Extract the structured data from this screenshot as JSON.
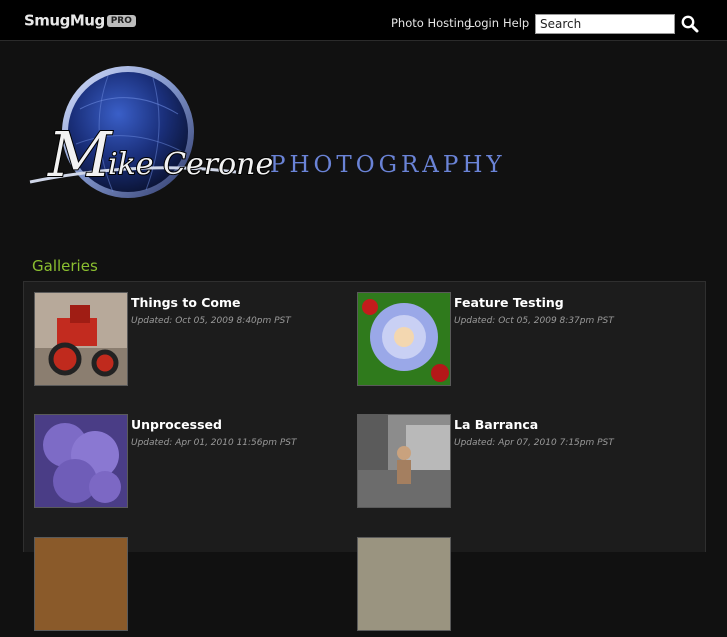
{
  "header": {
    "logo_text": "SmugMug",
    "logo_badge": "PRO",
    "nav": {
      "photo_hosting": "Photo Hosting",
      "login": "Login",
      "help": "Help"
    },
    "search": {
      "value": "",
      "placeholder": "Search",
      "icon": "search-icon"
    }
  },
  "banner": {
    "name_text": "Mike Cerone",
    "subtitle": "PHOTOGRAPHY"
  },
  "galleries": {
    "title": "Galleries",
    "items": [
      {
        "title": "Things to Come",
        "updated": "Updated: Oct 05, 2009 8:40pm PST",
        "thumb": "red-tractor"
      },
      {
        "title": "Feature Testing",
        "updated": "Updated: Oct 05, 2009 8:37pm PST",
        "thumb": "blue-flower"
      },
      {
        "title": "Unprocessed",
        "updated": "Updated: Apr 01, 2010 11:56pm PST",
        "thumb": "purple-hydrangea"
      },
      {
        "title": "La Barranca",
        "updated": "Updated: Apr 07, 2010 7:15pm PST",
        "thumb": "child-on-rocks"
      },
      {
        "title": "",
        "updated": "",
        "thumb": "brown-partial"
      },
      {
        "title": "",
        "updated": "",
        "thumb": "gray-partial"
      }
    ]
  },
  "colors": {
    "background": "#111111",
    "accent_green": "#8bbf30",
    "photography_blue": "#6a83d6"
  }
}
